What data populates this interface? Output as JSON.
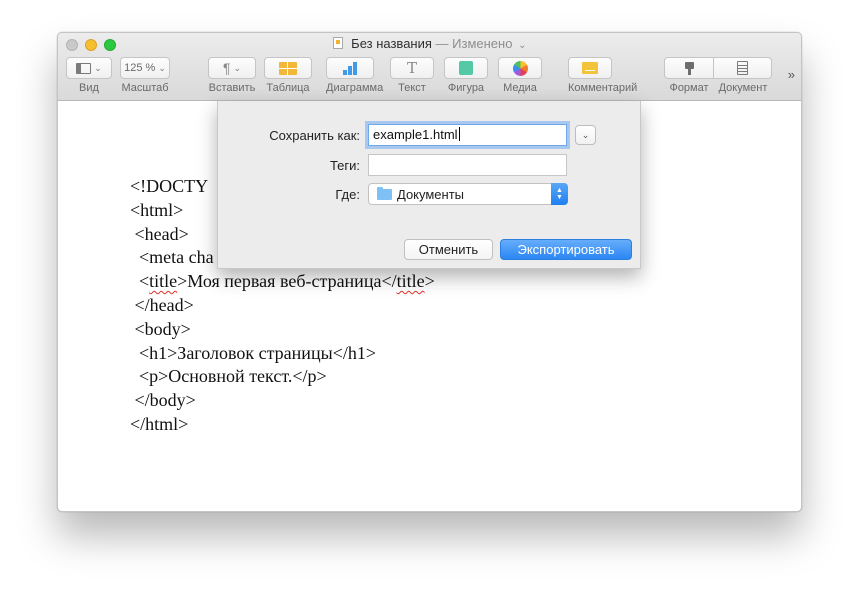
{
  "window": {
    "title": "Без названия",
    "separator": "—",
    "status": "Изменено"
  },
  "toolbar": {
    "view": {
      "label": "Вид",
      "icon": "sidebar-view-icon"
    },
    "zoom": {
      "label": "Масштаб",
      "value": "125 %"
    },
    "insert": {
      "label": "Вставить",
      "glyph": "¶"
    },
    "table": {
      "label": "Таблица"
    },
    "chart": {
      "label": "Диаграмма"
    },
    "text": {
      "label": "Текст",
      "glyph": "T"
    },
    "shape": {
      "label": "Фигура"
    },
    "media": {
      "label": "Медиа"
    },
    "comment": {
      "label": "Комментарий"
    },
    "format": {
      "label": "Формат"
    },
    "document": {
      "label": "Документ"
    },
    "overflow": "»"
  },
  "document": {
    "lines": {
      "l1": "<!DOCTY",
      "l2": "<html>",
      "l3": " <head>",
      "l4a": "  <meta cha",
      "l5a": "  <",
      "l5b": "title",
      "l5c": ">Моя первая веб-страница</",
      "l5d": "title",
      "l5e": ">",
      "l6": " </head>",
      "l7": " <body>",
      "l8": "  <h1>Заголовок страницы</h1>",
      "l9": "  <p>Основной текст.</p>",
      "l10": " </body>",
      "l11": "</html>"
    }
  },
  "export_sheet": {
    "save_as_label": "Сохранить как:",
    "save_as_value": "example1.html",
    "tags_label": "Теги:",
    "tags_value": "",
    "where_label": "Где:",
    "where_value": "Документы",
    "cancel_label": "Отменить",
    "export_label": "Экспортировать"
  },
  "colors": {
    "accent": "#2b86f3",
    "traffic_close": "#c9c9c9",
    "traffic_minimize": "#f5bf2f",
    "traffic_zoom": "#2cc840"
  }
}
